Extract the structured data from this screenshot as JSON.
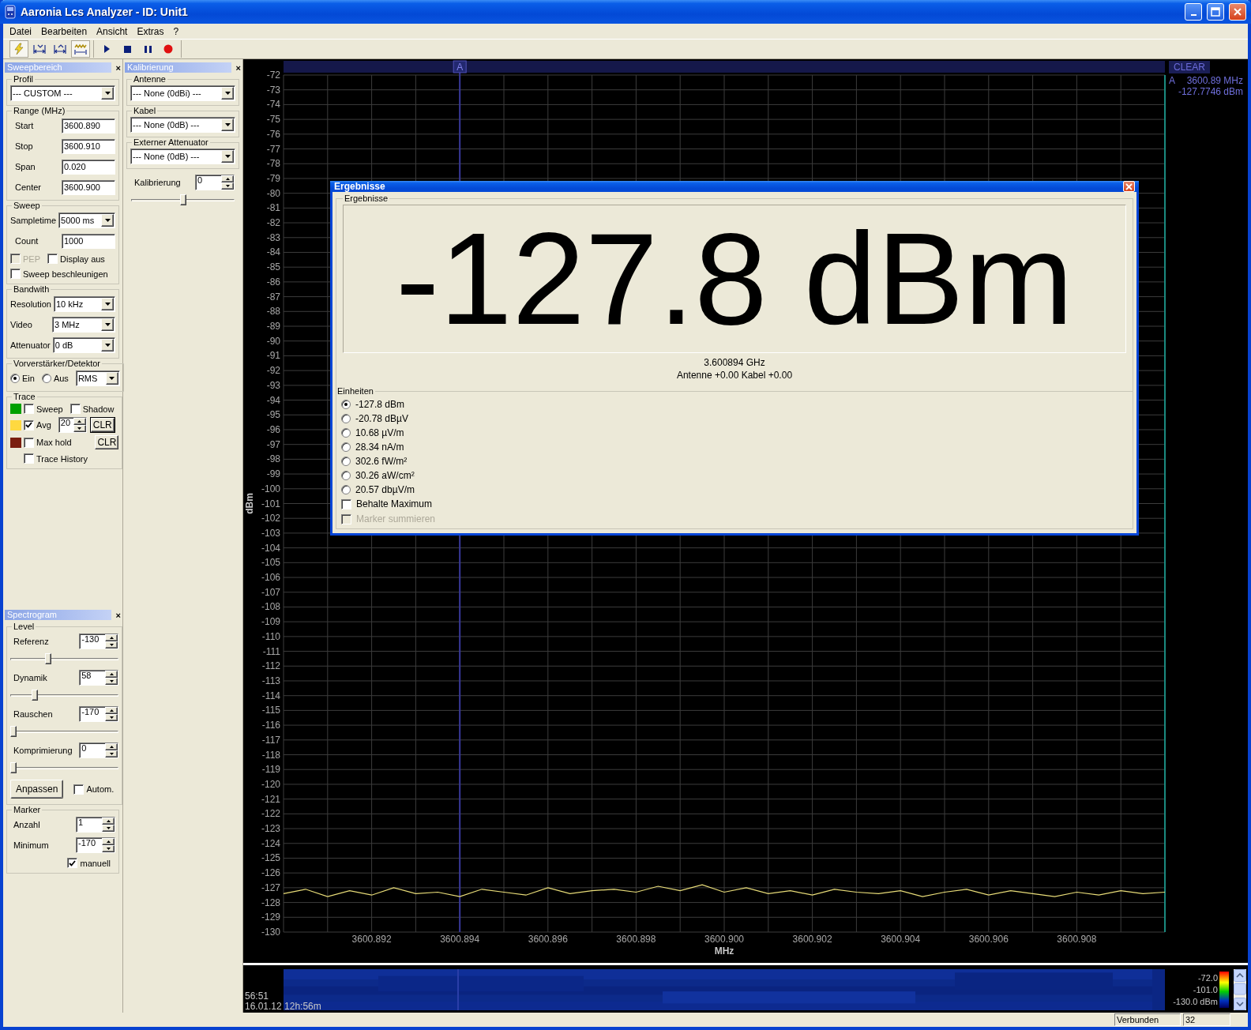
{
  "window": {
    "title": "Aaronia Lcs Analyzer - ID: Unit1"
  },
  "menu": [
    "Datei",
    "Bearbeiten",
    "Ansicht",
    "Extras",
    "?"
  ],
  "toolbar": [
    [
      {
        "kind": "lightning",
        "pressed": true
      },
      {
        "kind": "span-in",
        "pressed": false
      },
      {
        "kind": "span-out",
        "pressed": false
      },
      {
        "kind": "span-wave",
        "pressed": true
      }
    ],
    [
      {
        "kind": "play",
        "pressed": false
      },
      {
        "kind": "stop",
        "pressed": false
      },
      {
        "kind": "pause",
        "pressed": false
      },
      {
        "kind": "record",
        "pressed": false
      }
    ]
  ],
  "sweep_panel": {
    "title": "Sweepbereich",
    "close": "×",
    "groups": [
      {
        "legend": "Profil",
        "rows": [
          {
            "kind": "select",
            "value": "--- CUSTOM ---"
          }
        ]
      },
      {
        "legend": "Range (MHz)",
        "rows": [
          {
            "kind": "input",
            "label": "Start",
            "value": "3600.890"
          },
          {
            "kind": "input",
            "label": "Stop",
            "value": "3600.910"
          },
          {
            "kind": "input",
            "label": "Span",
            "value": "0.020"
          },
          {
            "kind": "input",
            "label": "Center",
            "value": "3600.900"
          }
        ]
      },
      {
        "legend": "Sweep",
        "rows": [
          {
            "kind": "select",
            "label": "Sampletime",
            "value": "5000 ms"
          },
          {
            "kind": "input",
            "label": "Count",
            "value": "1000"
          },
          {
            "kind": "checks",
            "items": [
              {
                "label": "PEP",
                "checked": false,
                "disabled": true
              },
              {
                "label": "Display aus",
                "checked": false,
                "disabled": false
              }
            ]
          },
          {
            "kind": "checks",
            "items": [
              {
                "label": "Sweep beschleunigen",
                "checked": false,
                "disabled": false
              }
            ]
          }
        ]
      },
      {
        "legend": "Bandwith",
        "rows": [
          {
            "kind": "select",
            "label": "Resolution",
            "value": "10 kHz"
          },
          {
            "kind": "select",
            "label": "Video",
            "value": "3 MHz"
          },
          {
            "kind": "select",
            "label": "Attenuator",
            "value": "0 dB"
          }
        ]
      },
      {
        "legend": "Vorverstärker/Detektor",
        "rows": [
          {
            "kind": "radios",
            "items": [
              {
                "label": "Ein",
                "selected": true
              },
              {
                "label": "Aus",
                "selected": false
              }
            ],
            "value": "RMS"
          }
        ]
      },
      {
        "legend": "Trace",
        "rows": [
          {
            "kind": "trace",
            "color": "#00a000",
            "items": [
              {
                "label": "Sweep",
                "checked": false
              },
              {
                "label": "Shadow",
                "checked": false
              }
            ]
          },
          {
            "kind": "trace",
            "color": "#ffd940",
            "items": [
              {
                "label": "Avg",
                "checked": true
              }
            ],
            "spin": "20",
            "button": "CLR"
          },
          {
            "kind": "trace",
            "color": "#7a1e10",
            "items": [
              {
                "label": "Max hold",
                "checked": false
              }
            ],
            "button": "CLR"
          },
          {
            "kind": "trace",
            "items": [
              {
                "label": "Trace History",
                "checked": false
              }
            ]
          }
        ]
      }
    ]
  },
  "spectrogram_panel": {
    "title": "Spectrogram",
    "close": "×",
    "groups": [
      {
        "legend": "Level",
        "rows": [
          {
            "kind": "spin",
            "label": "Referenz",
            "value": "-130",
            "level": 0.34
          },
          {
            "kind": "spin",
            "label": "Dynamik",
            "value": "58",
            "level": 0.21
          },
          {
            "kind": "spin",
            "label": "Rauschen",
            "value": "-170",
            "level": 0
          },
          {
            "kind": "spin",
            "label": "Komprimierung",
            "value": "0",
            "level": 0
          },
          {
            "kind": "button-check",
            "button": "Anpassen",
            "label": "Autom.",
            "checked": false
          }
        ]
      },
      {
        "legend": "Marker",
        "rows": [
          {
            "kind": "spin",
            "label": "Anzahl",
            "value": "1"
          },
          {
            "kind": "spin",
            "label": "Minimum",
            "value": "-170"
          },
          {
            "kind": "checks-right",
            "items": [
              {
                "label": "manuell",
                "checked": true
              }
            ]
          }
        ]
      }
    ]
  },
  "calibration_panel": {
    "title": "Kalibrierung",
    "close": "×",
    "groups": [
      {
        "legend": "Antenne",
        "rows": [
          {
            "kind": "select",
            "value": "--- None (0dBi) ---"
          }
        ]
      },
      {
        "legend": "Kabel",
        "rows": [
          {
            "kind": "select",
            "value": "--- None (0dB) ---"
          }
        ]
      },
      {
        "legend": "Externer Attenuator",
        "rows": [
          {
            "kind": "select",
            "value": "--- None (0dB) ---"
          }
        ]
      }
    ],
    "rows": [
      {
        "kind": "spin",
        "label": "Kalibrierung",
        "value": "0",
        "level": 0.5
      }
    ]
  },
  "chart": {
    "clear_button": "CLEAR",
    "marker_readout": {
      "label": "A",
      "frequency": "3600.89 MHz",
      "power": "-127.7746 dBm"
    },
    "chart_data": {
      "type": "line",
      "xlabel": "MHz",
      "ylabel": "dBm",
      "xlim": [
        3600.89,
        3600.91
      ],
      "ylim": [
        -130,
        -72
      ],
      "xticks": [
        {
          "value": 3600.892,
          "label": "3600.892"
        },
        {
          "value": 3600.894,
          "label": "3600.894"
        },
        {
          "value": 3600.896,
          "label": "3600.896"
        },
        {
          "value": 3600.898,
          "label": "3600.898"
        },
        {
          "value": 3600.9,
          "label": "3600.900"
        },
        {
          "value": 3600.902,
          "label": "3600.902"
        },
        {
          "value": 3600.904,
          "label": "3600.904"
        },
        {
          "value": 3600.906,
          "label": "3600.906"
        },
        {
          "value": 3600.908,
          "label": "3600.908"
        }
      ],
      "yticks": [
        -72,
        -73,
        -74,
        -75,
        -76,
        -77,
        -78,
        -79,
        -80,
        -81,
        -82,
        -83,
        -84,
        -85,
        -86,
        -87,
        -88,
        -89,
        -90,
        -91,
        -92,
        -93,
        -94,
        -95,
        -96,
        -97,
        -98,
        -99,
        -100,
        -101,
        -102,
        -103,
        -104,
        -105,
        -106,
        -107,
        -108,
        -109,
        -110,
        -111,
        -112,
        -113,
        -114,
        -115,
        -116,
        -117,
        -118,
        -119,
        -120,
        -121,
        -122,
        -123,
        -124,
        -125,
        -126,
        -127,
        -128,
        -129,
        -130
      ],
      "x": [
        3600.89,
        3600.8905,
        3600.891,
        3600.8915,
        3600.892,
        3600.8925,
        3600.893,
        3600.8935,
        3600.894,
        3600.8945,
        3600.895,
        3600.8955,
        3600.896,
        3600.8965,
        3600.897,
        3600.8975,
        3600.898,
        3600.8985,
        3600.899,
        3600.8995,
        3600.9,
        3600.9005,
        3600.901,
        3600.9015,
        3600.902,
        3600.9025,
        3600.903,
        3600.9035,
        3600.904,
        3600.9045,
        3600.905,
        3600.9055,
        3600.906,
        3600.9065,
        3600.907,
        3600.9075,
        3600.908,
        3600.9085,
        3600.909,
        3600.9095,
        3600.91
      ],
      "series": [
        {
          "color": "#e8dc78",
          "values": [
            -127.4,
            -127.1,
            -127.6,
            -127.2,
            -127.5,
            -127.0,
            -127.4,
            -127.3,
            -127.6,
            -127.1,
            -127.3,
            -127.5,
            -127.0,
            -127.4,
            -127.2,
            -127.1,
            -127.3,
            -126.9,
            -127.2,
            -126.8,
            -127.3,
            -127.0,
            -127.4,
            -127.2,
            -127.5,
            -127.1,
            -127.3,
            -127.4,
            -127.2,
            -127.6,
            -127.3,
            -127.1,
            -127.5,
            -127.2,
            -127.4,
            -127.6,
            -127.3,
            -127.5,
            -127.2,
            -127.4,
            -127.3
          ]
        }
      ],
      "grid": true,
      "ref_lines": [
        {
          "axis": "x",
          "value": 3600.894,
          "label": "A",
          "color": "#38389a"
        }
      ]
    }
  },
  "spectrogram": {
    "time": "56:51",
    "date": "16.01.12 12h:56m",
    "scale": [
      "-72.0",
      "-101.0",
      "-130.0 dBm"
    ]
  },
  "results_dialog": {
    "title": "Ergebnisse",
    "group": "Ergebnisse",
    "reading": "-127.8 dBm",
    "frequency": "3.600894 GHz",
    "offsets": "Antenne +0.00 Kabel +0.00",
    "units_legend": "Einheiten",
    "units": [
      {
        "label": "-127.8 dBm",
        "selected": true
      },
      {
        "label": "-20.78 dBµV",
        "selected": false
      },
      {
        "label": "10.68 µV/m",
        "selected": false
      },
      {
        "label": "28.34 nA/m",
        "selected": false
      },
      {
        "label": "302.6 fW/m²",
        "selected": false
      },
      {
        "label": "30.26 aW/cm²",
        "selected": false
      },
      {
        "label": "20.57 dbµV/m",
        "selected": false
      }
    ],
    "checks": [
      {
        "label": "Behalte Maximum",
        "checked": false,
        "disabled": false
      },
      {
        "label": "Marker summieren",
        "checked": false,
        "disabled": true
      }
    ]
  },
  "status_bar": [
    "Verbunden",
    "32"
  ]
}
